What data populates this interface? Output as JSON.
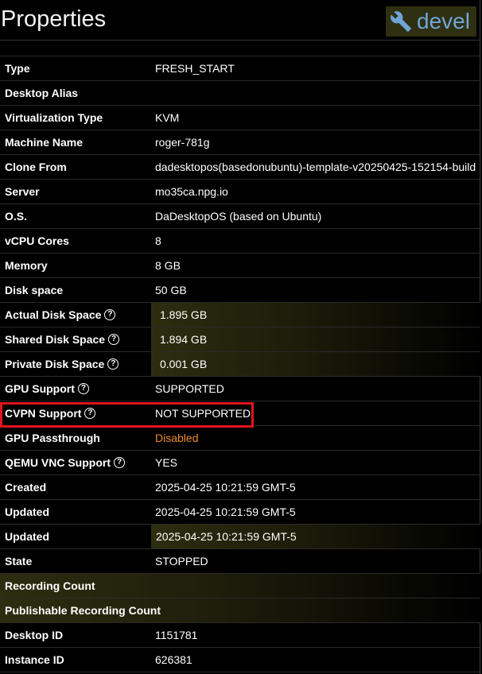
{
  "header": {
    "title": "Properties",
    "badge_label": "devel",
    "badge_icon": "wrench-icon"
  },
  "rows": [
    {
      "label": "Type",
      "value": "FRESH_START"
    },
    {
      "label": "Desktop Alias",
      "value": ""
    },
    {
      "label": "Virtualization Type",
      "value": "KVM"
    },
    {
      "label": "Machine Name",
      "value": "roger-781g"
    },
    {
      "label": "Clone From",
      "value": "dadesktopos(basedonubuntu)-template-v20250425-152154-build"
    },
    {
      "label": "Server",
      "value": "mo35ca.npg.io"
    },
    {
      "label": "O.S.",
      "value": "DaDesktopOS (based on Ubuntu)"
    },
    {
      "label": "vCPU Cores",
      "value": "8"
    },
    {
      "label": "Memory",
      "value": "8 GB"
    },
    {
      "label": "Disk space",
      "value": "50 GB"
    },
    {
      "label": "Actual Disk Space",
      "value": "1.895 GB",
      "help": "?"
    },
    {
      "label": "Shared Disk Space",
      "value": "1.894 GB",
      "help": "?"
    },
    {
      "label": "Private Disk Space",
      "value": "0.001 GB",
      "help": "?"
    },
    {
      "label": "GPU Support",
      "value": "SUPPORTED",
      "help": "?"
    },
    {
      "label": "CVPN Support",
      "value": "NOT SUPPORTED",
      "help": "?"
    },
    {
      "label": "GPU Passthrough",
      "value": "Disabled"
    },
    {
      "label": "QEMU VNC Support",
      "value": "YES",
      "help": "?"
    },
    {
      "label": "Created",
      "value": "2025-04-25 10:21:59 GMT-5"
    },
    {
      "label": "Updated",
      "value": "2025-04-25 10:21:59 GMT-5"
    },
    {
      "label": "Updated",
      "value": "2025-04-25 10:21:59 GMT-5"
    },
    {
      "label": "State",
      "value": "STOPPED"
    },
    {
      "label": "Recording Count",
      "value": ""
    },
    {
      "label": "Publishable Recording Count",
      "value": ""
    },
    {
      "label": "Desktop ID",
      "value": "1151781"
    },
    {
      "label": "Instance ID",
      "value": "626381"
    }
  ],
  "colors": {
    "disabled_value": "#f28c28",
    "highlight_border": "#e0141e",
    "badge_text": "#6fa6d6"
  }
}
